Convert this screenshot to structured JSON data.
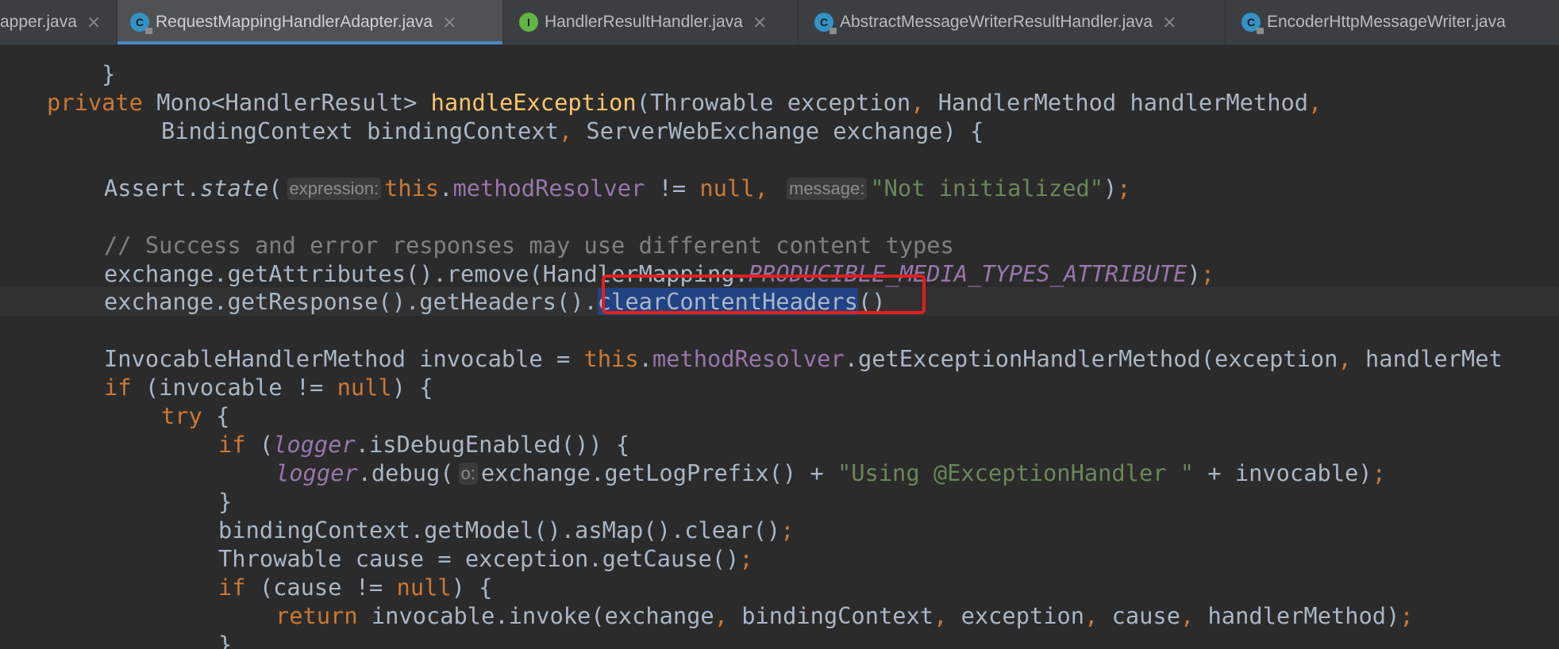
{
  "tabs": [
    {
      "label": "apper.java",
      "icon": "",
      "icon_color": "",
      "active": false
    },
    {
      "label": "RequestMappingHandlerAdapter.java",
      "icon": "C",
      "icon_color": "#3592c4",
      "active": true
    },
    {
      "label": "HandlerResultHandler.java",
      "icon": "I",
      "icon_color": "#62b543",
      "active": false
    },
    {
      "label": "AbstractMessageWriterResultHandler.java",
      "icon": "C",
      "icon_color": "#3592c4",
      "active": false
    },
    {
      "label": "EncoderHttpMessageWriter.java",
      "icon": "C",
      "icon_color": "#3592c4",
      "active": false
    }
  ],
  "tab_close_glyph": "×",
  "code": {
    "l1": {
      "brace": "}"
    },
    "l3": {
      "kw": "private",
      "type": "Mono<HandlerResult>",
      "name": "handleException",
      "p1": "(Throwable exception",
      "c1": ",",
      "p2": " HandlerMethod handlerMethod",
      "c2": ","
    },
    "l4": {
      "p1": "BindingContext bindingContext",
      "c1": ",",
      "p2": " ServerWebExchange exchange) {"
    },
    "l6": {
      "a": "Assert.",
      "b": "state",
      "c": "(",
      "hint1": "expression:",
      "this": "this",
      "dot": ".",
      "field": "methodResolver",
      "neq": " != ",
      "nul": "null",
      "comma": ",",
      "hint2": "message:",
      "str": "\"Not initialized\"",
      "end": ")",
      "semi": ";"
    },
    "l8": {
      "comment": "// Success and error responses may use different content types"
    },
    "l9": {
      "a": "exchange.getAttributes().remove(HandlerMapping.",
      "const": "PRODUCIBLE_MEDIA_TYPES_ATTRIBUTE",
      "b": ")",
      "semi": ";"
    },
    "l10": {
      "a": "exchange.getResponse().getHeaders()",
      "dot": ".",
      "sel": "clearContentHeaders",
      "b": "()"
    },
    "l12": {
      "a": "InvocableHandlerMethod invocable = ",
      "this": "this",
      "dot": ".",
      "field": "methodResolver",
      "b": ".getExceptionHandlerMethod(exception",
      "comma": ",",
      "c": " handlerMet"
    },
    "l13": {
      "kw": "if",
      "a": " (invocable != ",
      "nul": "null",
      "b": ") {"
    },
    "l14": {
      "kw": "try",
      "b": " {"
    },
    "l15": {
      "kw": "if",
      "a": " (",
      "logger": "logger",
      "b": ".isDebugEnabled()) {"
    },
    "l16": {
      "logger": "logger",
      "a": ".debug(",
      "hint": "o:",
      "b": "exchange.getLogPrefix() + ",
      "str": "\"Using @ExceptionHandler \"",
      "c": " + invocable)",
      "semi": ";"
    },
    "l17": {
      "brace": "}"
    },
    "l18": {
      "a": "bindingContext.getModel().asMap().clear()",
      "semi": ";"
    },
    "l19": {
      "a": "Throwable cause = exception.getCause()",
      "semi": ";"
    },
    "l20": {
      "kw": "if",
      "a": " (cause != ",
      "nul": "null",
      "b": ") {"
    },
    "l21": {
      "kw": "return",
      "a": " invocable.invoke(exchange",
      "c1": ",",
      "b": " bindingContext",
      "c2": ",",
      "c": " exception",
      "c3": ",",
      "d": " cause",
      "c4": ",",
      "e": " handlerMethod)",
      "semi": ";"
    },
    "l22": {
      "brace": "}"
    }
  }
}
